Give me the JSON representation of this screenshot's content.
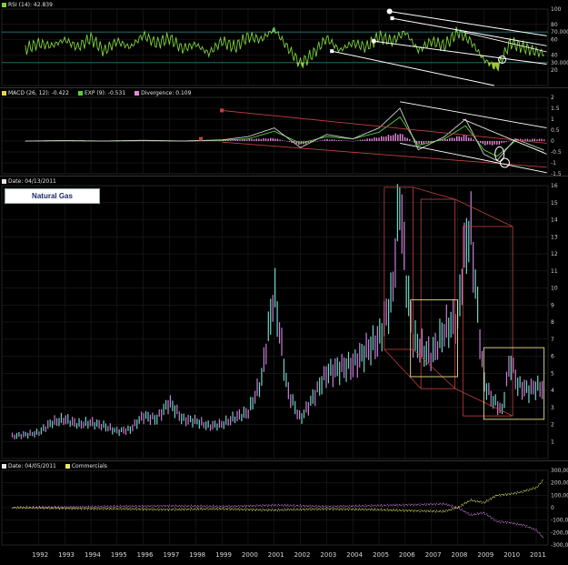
{
  "chart_data": [
    {
      "type": "line",
      "name": "rsi",
      "header": {
        "label": "RSI (14): 42.839",
        "color": "#7fd13b"
      },
      "ylim": [
        0,
        100
      ],
      "ticks": [
        "100",
        "80",
        "70.000",
        "60",
        "40",
        "30.000",
        "20"
      ],
      "tick_values": [
        100,
        80,
        70,
        60,
        40,
        30,
        20
      ],
      "reference_lines": [
        70,
        30
      ],
      "x_years": [
        1991.5,
        1992,
        1992.5,
        1993,
        1993.5,
        1994,
        1994.5,
        1995,
        1995.5,
        1996,
        1996.5,
        1997,
        1997.5,
        1998,
        1998.5,
        1999,
        1999.5,
        2000,
        2000.5,
        2001,
        2001.5,
        2002,
        2002.5,
        2003,
        2003.5,
        2004,
        2004.5,
        2005,
        2005.5,
        2006,
        2006.5,
        2007,
        2007.5,
        2008,
        2008.5,
        2009,
        2009.5,
        2010,
        2010.5,
        2011,
        2011.3
      ],
      "values": [
        48,
        55,
        52,
        60,
        50,
        62,
        45,
        58,
        50,
        66,
        55,
        62,
        48,
        54,
        42,
        58,
        50,
        64,
        60,
        74,
        50,
        28,
        42,
        62,
        46,
        56,
        50,
        64,
        58,
        70,
        46,
        58,
        52,
        70,
        58,
        34,
        22,
        56,
        50,
        44,
        42
      ]
    },
    {
      "type": "bar",
      "name": "macd",
      "header": [
        {
          "label": "MACD (26, 12): -0.422",
          "color": "#e8d84a"
        },
        {
          "label": "EXP (9): -0.531",
          "color": "#5ad13b"
        },
        {
          "label": "Divergence: 0.109",
          "color": "#e58ad9"
        }
      ],
      "ylim": [
        -1.5,
        2
      ],
      "ticks": [
        "2",
        "1.5",
        "1",
        "0.5",
        "0",
        "-0.5",
        "-1",
        "-1.5"
      ],
      "tick_values": [
        2,
        1.5,
        1,
        0.5,
        0,
        -0.5,
        -1,
        -1.5
      ],
      "x_years": [
        1991.5,
        1993,
        1994.5,
        1996,
        1997.5,
        1999,
        2000,
        2001,
        2002,
        2003,
        2004,
        2005,
        2005.8,
        2006.5,
        2007.5,
        2008.3,
        2009,
        2009.5,
        2010.2,
        2011.3
      ],
      "macd": [
        0,
        0.02,
        0,
        0.03,
        0,
        0.05,
        0.2,
        0.6,
        -0.3,
        0.3,
        0.1,
        0.6,
        1.5,
        -0.4,
        0.2,
        1.0,
        -0.6,
        -0.9,
        0.1,
        -0.42
      ],
      "signal": [
        0,
        0.01,
        0,
        0.02,
        0,
        0.03,
        0.1,
        0.45,
        -0.1,
        0.2,
        0.1,
        0.4,
        1.1,
        -0.2,
        0.1,
        0.7,
        -0.4,
        -0.7,
        0,
        -0.53
      ],
      "divergence": [
        0,
        0.01,
        0,
        0.01,
        0,
        0.02,
        0.1,
        0.15,
        -0.2,
        0.1,
        0,
        0.2,
        0.4,
        -0.2,
        0.1,
        0.3,
        -0.2,
        -0.2,
        0.1,
        0.109
      ]
    },
    {
      "type": "line",
      "name": "price",
      "header": {
        "label": "Date: 04/13/2011",
        "color": "#e6e6e6"
      },
      "title": "Natural Gas",
      "ylim": [
        0,
        16
      ],
      "ticks": [
        "16",
        "15",
        "14",
        "13",
        "12",
        "11",
        "10",
        "9",
        "8",
        "7",
        "6",
        "5",
        "4",
        "3",
        "2",
        "1"
      ],
      "tick_values": [
        16,
        15,
        14,
        13,
        12,
        11,
        10,
        9,
        8,
        7,
        6,
        5,
        4,
        3,
        2,
        1
      ],
      "x_years": [
        1991,
        1991.5,
        1992,
        1992.5,
        1993,
        1993.5,
        1994,
        1994.5,
        1995,
        1995.5,
        1996,
        1996.5,
        1997,
        1997.5,
        1998,
        1998.5,
        1999,
        1999.5,
        2000,
        2000.5,
        2001,
        2001.5,
        2002,
        2002.5,
        2003,
        2003.5,
        2004,
        2004.5,
        2005,
        2005.5,
        2005.8,
        2006,
        2006.3,
        2006.7,
        2007,
        2007.5,
        2008,
        2008.3,
        2008.5,
        2008.8,
        2009,
        2009.3,
        2009.7,
        2010,
        2010.3,
        2010.7,
        2011,
        2011.3
      ],
      "values": [
        1.3,
        1.4,
        1.5,
        2.1,
        2.3,
        2.0,
        2.1,
        1.9,
        1.6,
        1.7,
        2.5,
        2.3,
        3.3,
        2.3,
        2.2,
        1.9,
        2.0,
        2.4,
        2.7,
        4.5,
        9.8,
        4.0,
        2.3,
        3.6,
        5.0,
        5.3,
        5.5,
        6.3,
        7.0,
        9.5,
        15.5,
        11.0,
        7.0,
        6.3,
        6.0,
        7.5,
        8.2,
        12.5,
        13.5,
        8.0,
        4.5,
        3.5,
        2.8,
        5.8,
        4.3,
        4.0,
        4.2,
        4.1
      ]
    },
    {
      "type": "line",
      "name": "cot",
      "header": [
        {
          "label": "Date: 04/05/2011",
          "color": "#e6e6e6"
        },
        {
          "label": "Commercials",
          "color": "#e8e86a"
        }
      ],
      "ylim": [
        -300000,
        300000
      ],
      "ticks": [
        "300,000",
        "200,000",
        "100,000",
        "0",
        "-100,000",
        "-200,000",
        "-300,000"
      ],
      "tick_values": [
        300000,
        200000,
        100000,
        0,
        -100000,
        -200000,
        -300000
      ],
      "x_years": [
        1991,
        1993,
        1995,
        1997,
        1999,
        2001,
        2003,
        2004.5,
        2005.5,
        2006.5,
        2007.5,
        2008,
        2008.5,
        2009,
        2009.5,
        2010,
        2010.5,
        2011,
        2011.3
      ],
      "commercials": [
        0,
        -5000,
        -10000,
        -15000,
        -10000,
        -20000,
        -10000,
        -15000,
        -20000,
        -25000,
        -30000,
        0,
        60000,
        40000,
        100000,
        110000,
        130000,
        160000,
        230000
      ],
      "other": [
        0,
        5000,
        10000,
        15000,
        10000,
        20000,
        10000,
        15000,
        20000,
        25000,
        30000,
        0,
        -60000,
        -40000,
        -110000,
        -120000,
        -140000,
        -180000,
        -250000
      ]
    }
  ],
  "x_axis": {
    "labels": [
      "1992",
      "1993",
      "1994",
      "1995",
      "1996",
      "1997",
      "1998",
      "1999",
      "2000",
      "2001",
      "2002",
      "2003",
      "2004",
      "2005",
      "2006",
      "2007",
      "2008",
      "2009",
      "2010",
      "2011"
    ],
    "tick_values": [
      1992,
      1993,
      1994,
      1995,
      1996,
      1997,
      1998,
      1999,
      2000,
      2001,
      2002,
      2003,
      2004,
      2005,
      2006,
      2007,
      2008,
      2009,
      2010,
      2011
    ]
  },
  "colors": {
    "rsi_line": "#7fd13b",
    "rsi_fill_high": "#3fc5b5",
    "rsi_fill_low": "#c8d72c",
    "macd_line": "#cfcfcf",
    "signal_line": "#5ad13b",
    "divergence": "#e58ad9",
    "price_up": "#6fd3c3",
    "price_down": "#c77fd6",
    "commercials": "#e8e86a",
    "other": "#c77fd6",
    "annotation_white": "#ffffff",
    "annotation_red": "#c24040",
    "annotation_yellow": "#e8e090",
    "grid": "#262626",
    "reference": "#2a7d78"
  }
}
